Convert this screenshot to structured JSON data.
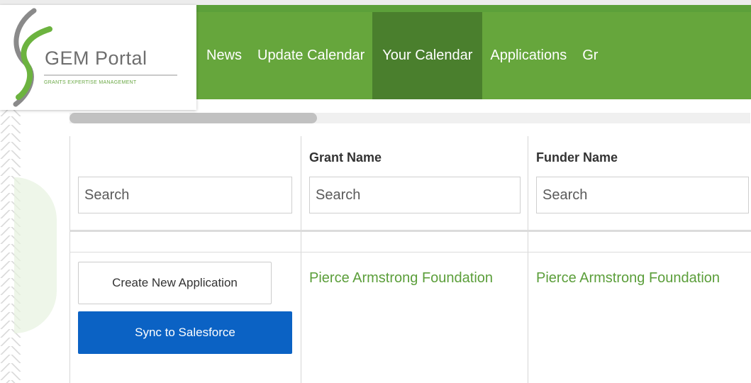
{
  "logo": {
    "title": "GEM Portal",
    "subtitle": "GRANTS EXPERTISE MANAGEMENT"
  },
  "nav": {
    "items": [
      {
        "label": "News"
      },
      {
        "label": "Update Calendar"
      },
      {
        "label": "Your Calendar",
        "active": true
      },
      {
        "label": "Applications"
      },
      {
        "label": "Gr"
      }
    ]
  },
  "table": {
    "headers": [
      "",
      "Grant Name",
      "Funder Name"
    ],
    "search_placeholder": "Search",
    "rows": [
      {
        "actions": {
          "create_label": "Create New Application",
          "sync_label": "Sync to Salesforce"
        },
        "grant_name": "Pierce Armstrong Foundation",
        "funder_name": "Pierce Armstrong Foundation"
      }
    ]
  },
  "colors": {
    "nav_green": "#66a63c",
    "nav_active": "#4a7f2d",
    "link_green": "#5b9e3a",
    "button_blue": "#0b62c4"
  }
}
